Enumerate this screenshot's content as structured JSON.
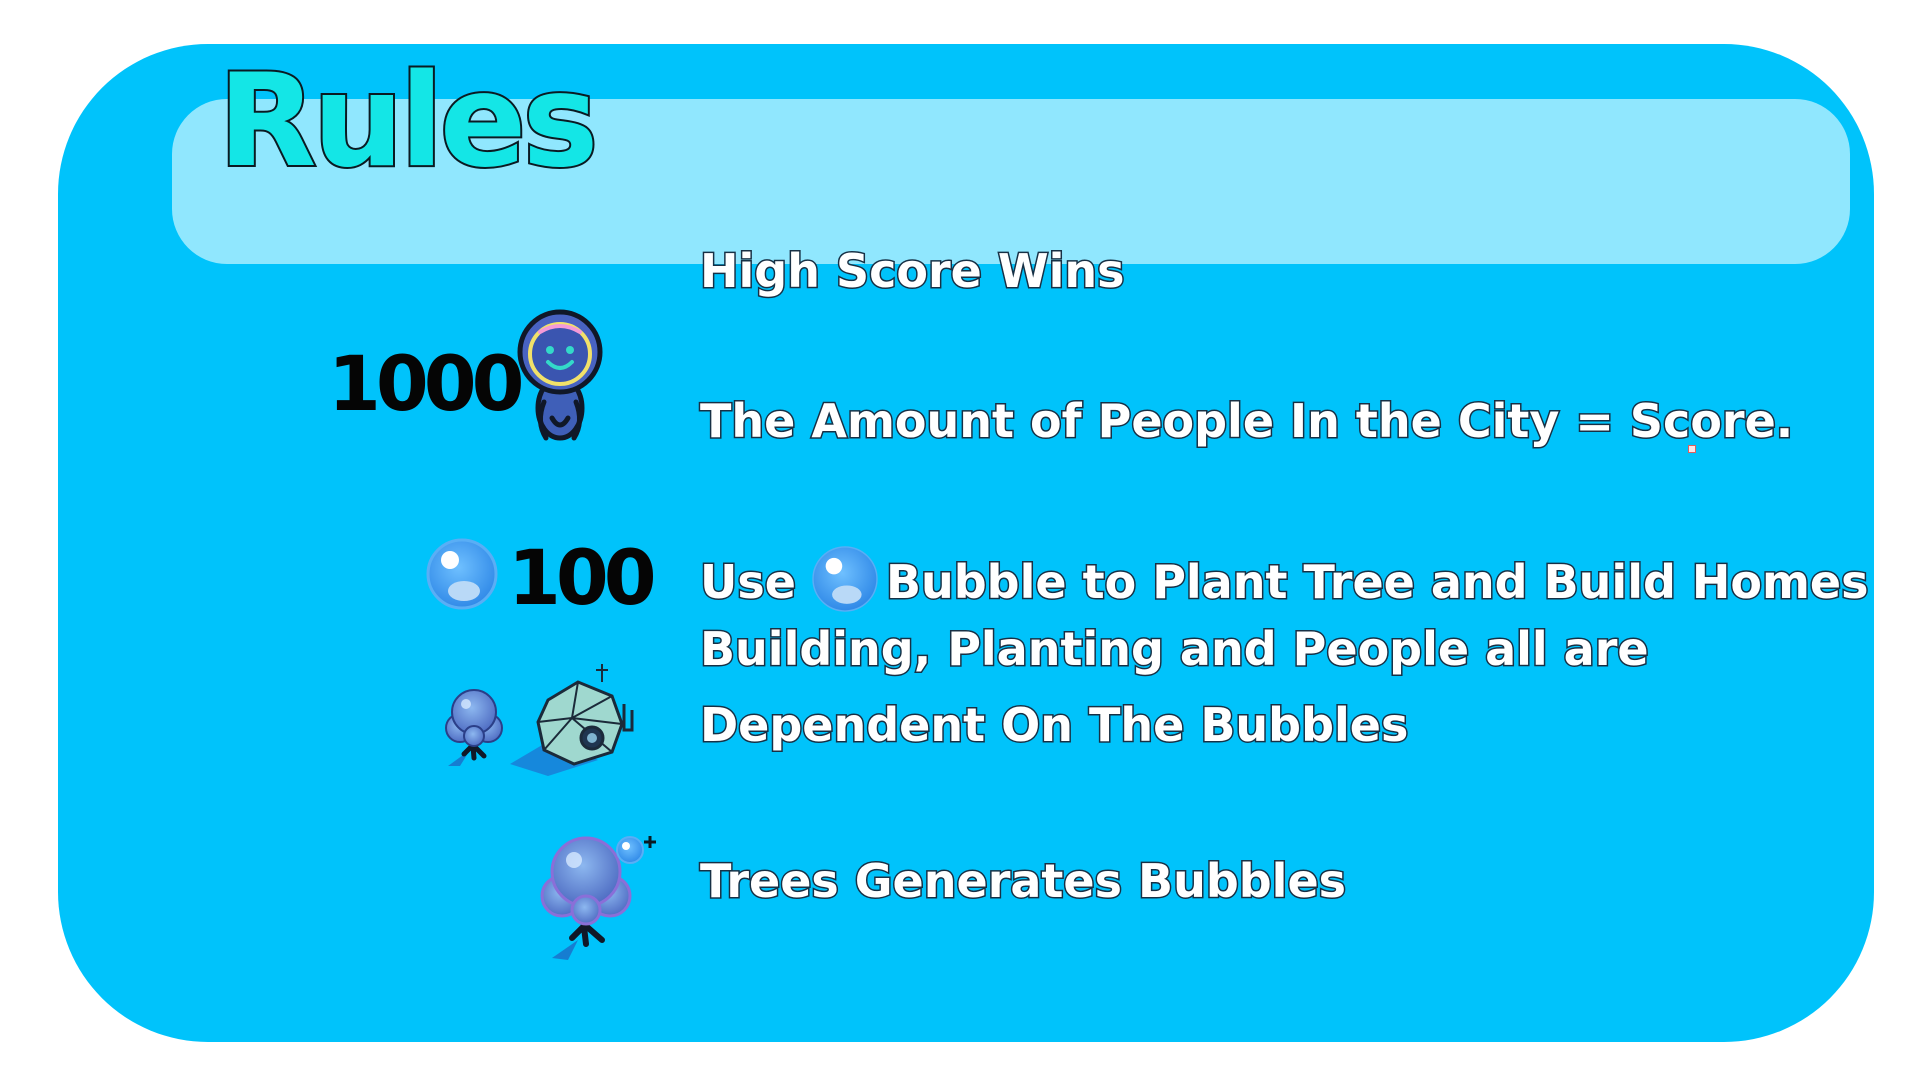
{
  "title": "Rules",
  "score_example": {
    "value": "1000",
    "icon": "person-icon"
  },
  "bubble_example": {
    "value": "100",
    "icon": "bubble-icon"
  },
  "rules": {
    "high_score": "High Score Wins",
    "people_score": "The Amount of People In the City = Score.",
    "use_prefix": "Use",
    "use_suffix": "Bubble to Plant Tree and Build Homes",
    "dependent_line1": "Building, Planting and People all are",
    "dependent_line2": "Dependent On The Bubbles",
    "trees_generate": "Trees Generates Bubbles"
  },
  "icons": {
    "bubble": "bubble-icon",
    "person": "person-icon",
    "tree": "bubble-tree-icon",
    "home": "dome-home-icon",
    "tree_generating": "tree-generating-bubbles-icon"
  },
  "colors": {
    "panel": "#00c3fb",
    "header": "#90e7fe",
    "title": "#14e6e6",
    "bubble": "#3fa2f4"
  }
}
